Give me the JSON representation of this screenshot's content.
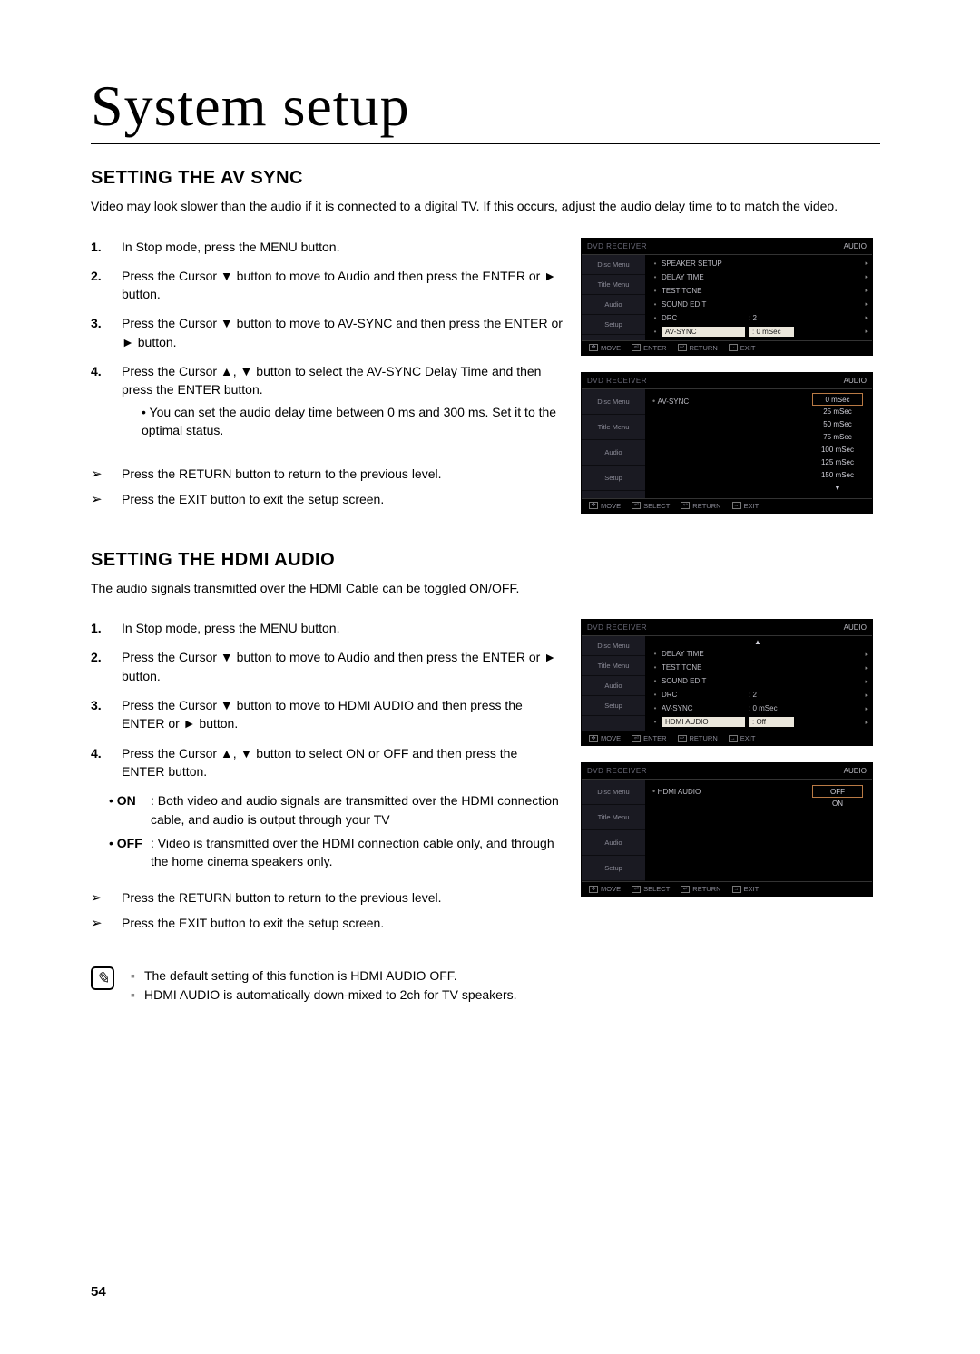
{
  "page_title": "System setup",
  "page_number": "54",
  "section1": {
    "heading": "SETTING THE AV SYNC",
    "intro": "Video may look slower than the audio if it is connected to a digital TV. If this occurs, adjust the audio delay time to to match the video.",
    "steps": [
      "In Stop mode, press the MENU button.",
      "Press the Cursor ▼ button to move to Audio and then press the ENTER or ► button.",
      "Press the Cursor ▼ button to move to AV-SYNC and then press the ENTER or ► button.",
      "Press the Cursor ▲, ▼ button to select the AV-SYNC Delay Time and then press the ENTER button."
    ],
    "sub": "• You can set the audio delay time between 0 ms and 300 ms. Set it to the optimal status.",
    "tips": [
      "Press the RETURN button to return to the previous level.",
      "Press the EXIT button to exit the setup screen."
    ]
  },
  "section2": {
    "heading": "SETTING THE HDMI AUDIO",
    "intro": "The audio signals transmitted over the HDMI Cable can be toggled ON/OFF.",
    "steps": [
      "In Stop mode, press the MENU button.",
      "Press the Cursor ▼ button to move to Audio and then press the ENTER or ► button.",
      "Press the Cursor ▼ button to move to HDMI AUDIO and then press the ENTER or ► button.",
      "Press the Cursor ▲, ▼ button to select ON or OFF and then press the ENTER button."
    ],
    "desc": [
      {
        "label": "ON",
        "text": ": Both video and audio signals are transmitted over the HDMI connection cable, and audio is output through your TV"
      },
      {
        "label": "OFF",
        "text": ": Video is transmitted over the HDMI connection cable only, and through the home cinema speakers only."
      }
    ],
    "tips": [
      "Press the RETURN button to return to the previous level.",
      "Press the EXIT button to exit the setup screen."
    ],
    "notes": [
      "The default setting of this function is HDMI AUDIO OFF.",
      "HDMI AUDIO is automatically down-mixed to 2ch for TV speakers."
    ]
  },
  "osd": {
    "top_label": "DVD RECEIVER",
    "top_right": "AUDIO",
    "side": [
      "Disc Menu",
      "Title Menu",
      "Audio",
      "Setup"
    ],
    "bottom_move": "MOVE",
    "bottom_enter": "ENTER",
    "bottom_select": "SELECT",
    "bottom_return": "RETURN",
    "bottom_exit": "EXIT",
    "menu1": [
      {
        "name": "SPEAKER SETUP",
        "val": "",
        "tri": true
      },
      {
        "name": "DELAY TIME",
        "val": "",
        "tri": true
      },
      {
        "name": "TEST TONE",
        "val": "",
        "tri": true
      },
      {
        "name": "SOUND EDIT",
        "val": "",
        "tri": true
      },
      {
        "name": "DRC",
        "val": "2",
        "tri": true
      },
      {
        "name": "AV-SYNC",
        "val": "0 mSec",
        "sel": true,
        "tri": true
      }
    ],
    "menu2_name": "AV-SYNC",
    "menu2_opts": [
      "0 mSec",
      "25 mSec",
      "50 mSec",
      "75 mSec",
      "100 mSec",
      "125 mSec",
      "150 mSec"
    ],
    "menu3": [
      {
        "name": "DELAY TIME",
        "up": true,
        "tri": true
      },
      {
        "name": "TEST TONE",
        "tri": true
      },
      {
        "name": "SOUND EDIT",
        "tri": true
      },
      {
        "name": "DRC",
        "val": "2",
        "tri": true
      },
      {
        "name": "AV-SYNC",
        "val": "0 mSec",
        "tri": true
      },
      {
        "name": "HDMI AUDIO",
        "val": "Off",
        "sel": true,
        "tri": true
      }
    ],
    "menu4_name": "HDMI AUDIO",
    "menu4_opts": [
      "OFF",
      "ON"
    ]
  }
}
